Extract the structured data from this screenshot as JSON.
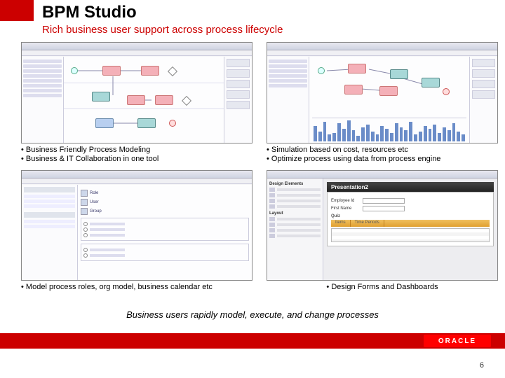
{
  "title": "BPM Studio",
  "subtitle": "Rich business user support across process lifecycle",
  "quadrants": {
    "tl": {
      "caption1": "Business Friendly Process Modeling",
      "caption2": "Business & IT Collaboration in one tool"
    },
    "tr": {
      "caption1": "Simulation based on cost, resources etc",
      "caption2": "Optimize process using data from process engine"
    },
    "bl": {
      "caption1": "Model process roles, org model, business calendar etc"
    },
    "br": {
      "caption1": "Design Forms and Dashboards",
      "presentation_label": "Presentation2",
      "form": {
        "field1_label": "Employee Id",
        "field2_label": "First Name",
        "section_label": "Quiz",
        "tab1": "Items",
        "tab2": "Time Periods"
      }
    }
  },
  "tagline": "Business users rapidly model, execute, and change processes",
  "logo_text": "ORACLE",
  "page_number": "6",
  "chart_data": {
    "type": "bar",
    "note": "Decorative simulation histogram inside top-right screenshot; values are illustrative relative heights, no axis labels visible.",
    "values": [
      22,
      14,
      28,
      10,
      12,
      26,
      18,
      30,
      16,
      8,
      20,
      24,
      14,
      10,
      22,
      18,
      12,
      26,
      20,
      16,
      28,
      10,
      14,
      22,
      18,
      24,
      12,
      20,
      16,
      26,
      14,
      10
    ]
  }
}
